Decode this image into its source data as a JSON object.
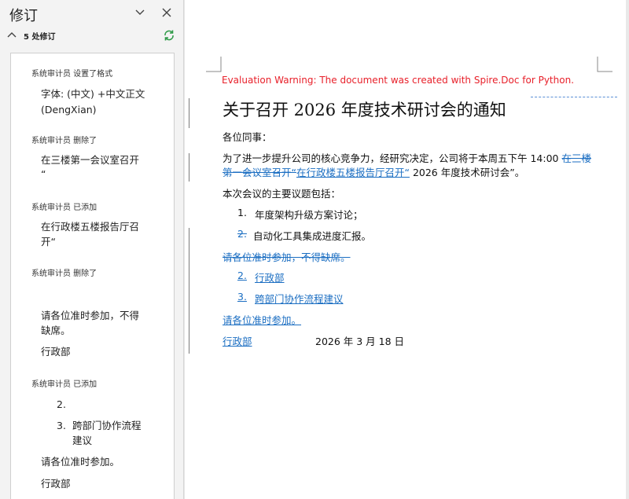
{
  "pane": {
    "title": "修订",
    "count_label": "5 处修订"
  },
  "revisions": [
    {
      "header": "系统审计员  设置了格式",
      "lines": [
        "字体: (中文) +中文正文",
        "(DengXian)"
      ]
    },
    {
      "header": "系统审计员  删除了",
      "lines": [
        "在三楼第一会议室召开",
        "“"
      ]
    },
    {
      "header": "系统审计员  已添加",
      "lines": [
        "在行政楼五楼报告厅召",
        "开“"
      ]
    },
    {
      "header": "系统审计员  删除了",
      "lines": [
        "请各位准时参加，不得",
        "缺席。",
        "行政部"
      ]
    },
    {
      "header": "系统审计员  已添加",
      "lines": [
        "2.",
        "3.",
        "跨部门协作流程",
        "建议",
        "请各位准时参加。",
        "行政部"
      ]
    }
  ],
  "document": {
    "eval_warning": "Evaluation Warning: The document was created with Spire.Doc for Python.",
    "title": "关于召开 2026 年度技术研讨会的通知",
    "greeting": "各位同事：",
    "p1_a": "为了进一步提升公司的核心竞争力，经研究决定，公司将于本周五下午 14:00 ",
    "p1_del_a": "在三楼",
    "p1_del_b": "第一会议室召开“",
    "p1_ins": "在行政楼五楼报告厅召开“",
    "p1_b": " 2026 年度技术研讨会”。",
    "agenda_intro": "本次会议的主要议题包括：",
    "item1_num": "1.",
    "item1_text": "年度架构升级方案讨论；",
    "item2_num": "2.",
    "item2_text": "自动化工具集成进度汇报。",
    "deleted_note": "请各位准时参加，不得缺席。",
    "ins_item2_num": "2.",
    "ins_item2_text": "行政部",
    "ins_item3_num": "3.",
    "ins_item3_text": "跨部门协作流程建议",
    "ins_note": "请各位准时参加。",
    "sign_dept": "行政部",
    "sign_date": "2026 年 3 月 18 日"
  },
  "colors": {
    "insert": "#1b6ec2",
    "warning": "#e8202a",
    "refresh": "#2e9a47"
  }
}
